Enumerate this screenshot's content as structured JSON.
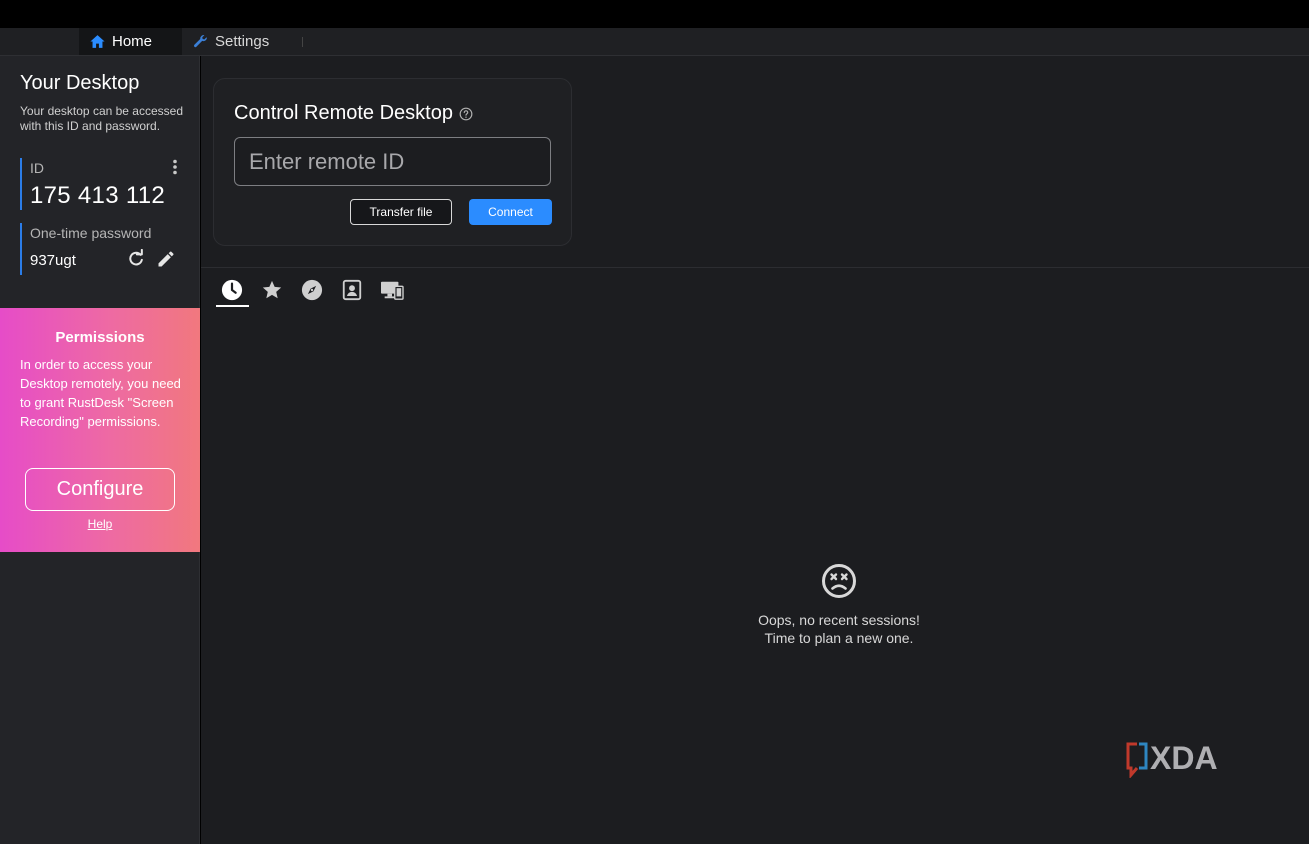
{
  "tabs": [
    {
      "label": "Home",
      "icon": "home-icon"
    },
    {
      "label": "Settings",
      "icon": "wrench-icon"
    }
  ],
  "sidebar": {
    "title": "Your Desktop",
    "description": "Your desktop can be accessed with this ID and password.",
    "id_label": "ID",
    "id_value": "175 413 112",
    "password_label": "One-time password",
    "password_value": "937ugt"
  },
  "permissions": {
    "title": "Permissions",
    "text": "In order to access your Desktop remotely, you need to grant RustDesk \"Screen Recording\" permissions.",
    "configure_label": "Configure",
    "help_label": "Help"
  },
  "control": {
    "title": "Control Remote Desktop",
    "input_placeholder": "Enter remote ID",
    "input_value": "",
    "transfer_label": "Transfer file",
    "connect_label": "Connect"
  },
  "session_tabs": [
    {
      "icon": "clock-icon",
      "name": "recent-sessions",
      "selected": true
    },
    {
      "icon": "star-icon",
      "name": "favorites",
      "selected": false
    },
    {
      "icon": "compass-icon",
      "name": "discovered",
      "selected": false
    },
    {
      "icon": "address-book-icon",
      "name": "address-book",
      "selected": false
    },
    {
      "icon": "group-devices-icon",
      "name": "group",
      "selected": false
    }
  ],
  "empty_state": {
    "icon": "sad-face-icon",
    "line1": "Oops, no recent sessions!",
    "line2": "Time to plan a new one."
  },
  "watermark": "XDA",
  "colors": {
    "accent": "#2b8cff",
    "id_border": "#2b7de9",
    "permission_gradient_start": "#e64cc8",
    "permission_gradient_end": "#f1787e"
  }
}
